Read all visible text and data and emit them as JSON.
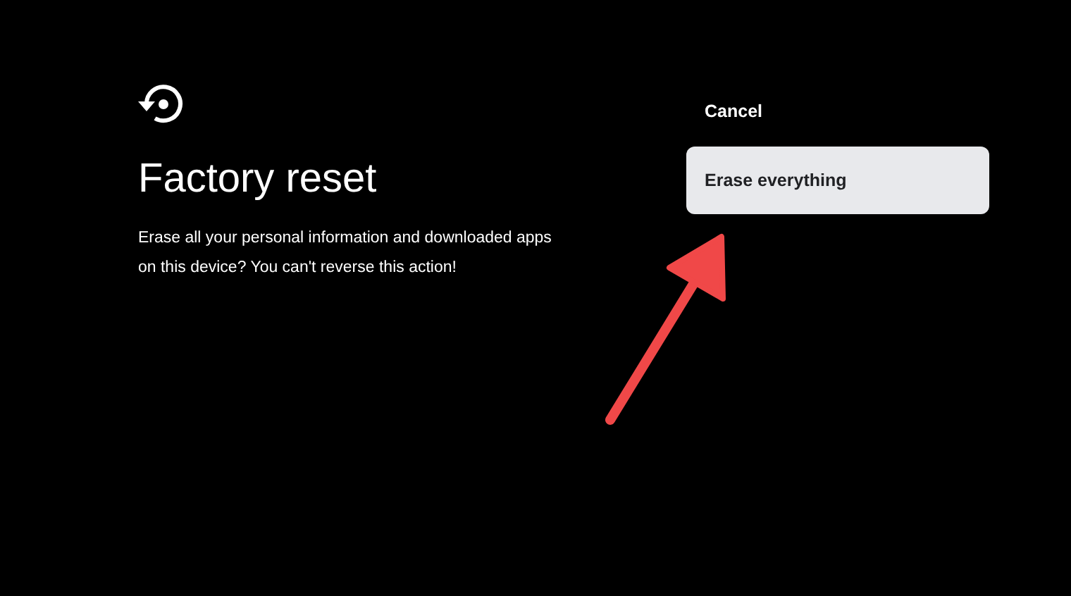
{
  "dialog": {
    "title": "Factory reset",
    "description": "Erase all your personal information and downloaded apps on this device? You can't reverse this action!"
  },
  "actions": [
    {
      "label": "Cancel",
      "selected": false
    },
    {
      "label": "Erase everything",
      "selected": true
    }
  ]
}
